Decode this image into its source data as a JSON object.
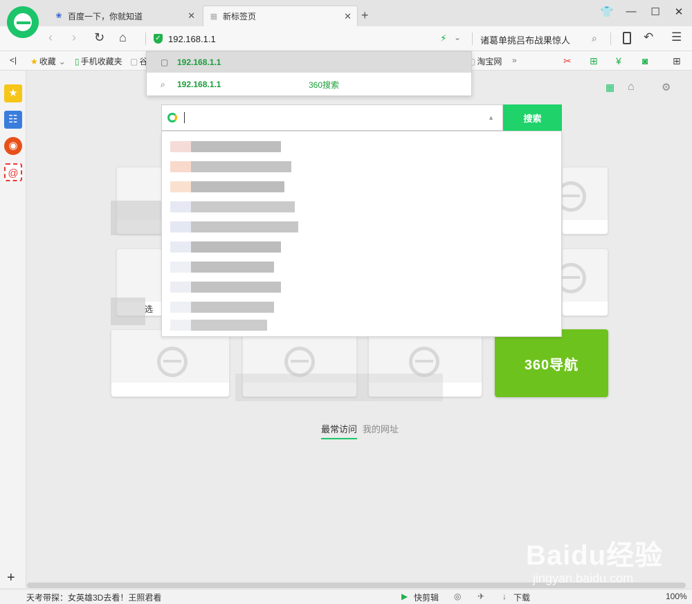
{
  "tabs": [
    {
      "title": "百度一下，你就知道",
      "icon": "paw-icon"
    },
    {
      "title": "新标签页",
      "icon": "grid-icon"
    }
  ],
  "new_tab_symbol": "+",
  "window": {
    "skin": "👕",
    "minimize": "—",
    "maximize": "☐",
    "close": "✕"
  },
  "address": {
    "url": "192.168.1.1"
  },
  "search_hint": "诸葛单挑吕布战果惊人",
  "url_dropdown": {
    "items": [
      {
        "text": "192.168.1.1",
        "source": ""
      },
      {
        "text": "192.168.1.1",
        "source": "360搜索"
      }
    ]
  },
  "favorites": {
    "collapse": "<|",
    "collect": "收藏",
    "mobile": "手机收藏夹",
    "partial": "谷",
    "taobao": "淘宝网",
    "more": "»"
  },
  "search": {
    "button": "搜索"
  },
  "nav360": {
    "label": "360导航"
  },
  "bottom_tabs": {
    "frequent": "最常访问",
    "mysites": "我的网址"
  },
  "tile_text": {
    "partial": "选"
  },
  "status": {
    "news": "天考带探：女英雄3D去看！王照君看",
    "shortcut": "快剪辑",
    "download": "下载",
    "zoom": "100%"
  },
  "watermark": {
    "main": "Baidu经验",
    "sub": "jingyan.baidu.com"
  },
  "colors": {
    "accent": "#1cc46a",
    "nav360": "#6ec21e",
    "link": "#1b9e3a"
  }
}
